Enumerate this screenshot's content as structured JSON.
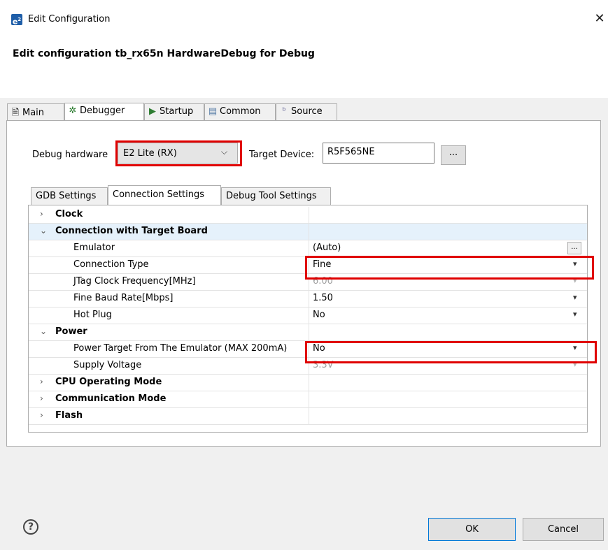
{
  "window": {
    "title": "Edit Configuration",
    "app_icon": "e²"
  },
  "header": {
    "text": "Edit configuration tb_rx65n HardwareDebug for Debug"
  },
  "main_tabs": [
    {
      "label": "Main",
      "icon": "document-icon"
    },
    {
      "label": "Debugger",
      "icon": "bug-icon"
    },
    {
      "label": "Startup",
      "icon": "play-icon"
    },
    {
      "label": "Common",
      "icon": "table-icon"
    },
    {
      "label": "Source",
      "icon": "source-icon"
    }
  ],
  "active_main_tab": "Debugger",
  "debug_hardware": {
    "label": "Debug hardware",
    "value": "E2 Lite (RX)"
  },
  "target_device": {
    "label": "Target Device:",
    "value": "R5F565NE",
    "browse_label": "..."
  },
  "sub_tabs": [
    "GDB Settings",
    "Connection Settings",
    "Debug Tool Settings"
  ],
  "active_sub_tab": "Connection Settings",
  "properties": {
    "clock": {
      "name": "Clock"
    },
    "connection": {
      "name": "Connection with Target Board",
      "emulator": {
        "name": "Emulator",
        "value": "(Auto)"
      },
      "connection_type": {
        "name": "Connection Type",
        "value": "Fine"
      },
      "jtag_freq": {
        "name": "JTag Clock Frequency[MHz]",
        "value": "6.00"
      },
      "fine_baud": {
        "name": "Fine Baud Rate[Mbps]",
        "value": "1.50"
      },
      "hot_plug": {
        "name": "Hot Plug",
        "value": "No"
      }
    },
    "power": {
      "name": "Power",
      "power_target": {
        "name": "Power Target From The Emulator (MAX 200mA)",
        "value": "No"
      },
      "supply_voltage": {
        "name": "Supply Voltage",
        "value": "3.3V"
      }
    },
    "cpu_mode": {
      "name": "CPU Operating Mode"
    },
    "comm_mode": {
      "name": "Communication Mode"
    },
    "flash": {
      "name": "Flash"
    }
  },
  "buttons": {
    "ok": "OK",
    "cancel": "Cancel"
  },
  "colors": {
    "highlight_box": "#e00000",
    "accent": "#0078d7",
    "dialog_bg": "#f0f0f0"
  }
}
